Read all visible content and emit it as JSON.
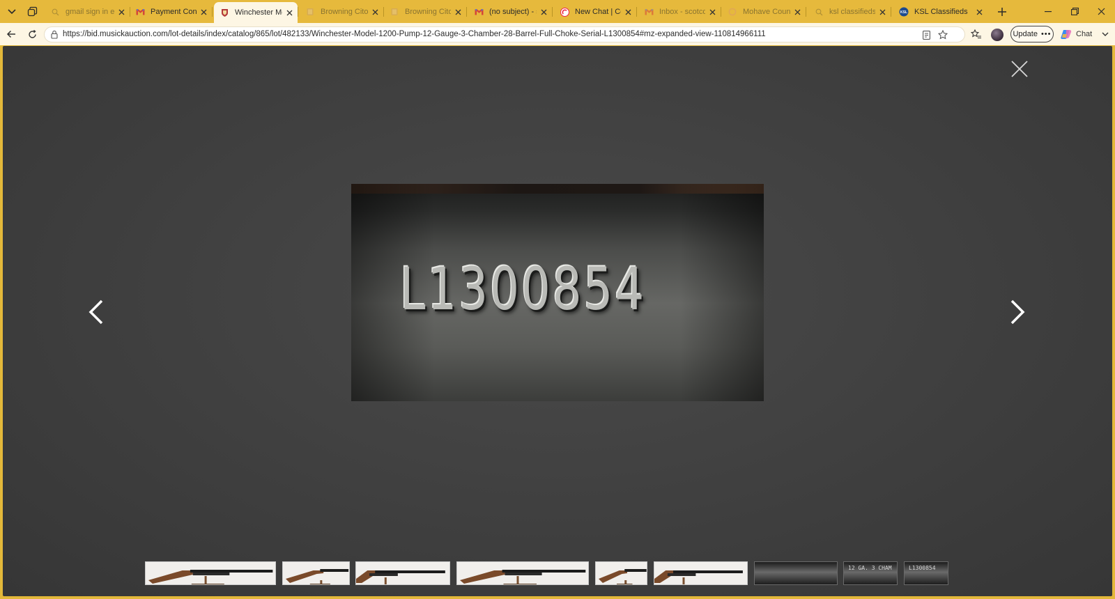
{
  "browser": {
    "tabs": [
      {
        "title": "gmail sign in en",
        "favicon": "search-icon",
        "state": "faded"
      },
      {
        "title": "Payment Confirm",
        "favicon": "gmail-icon",
        "state": "normal"
      },
      {
        "title": "Winchester Mode",
        "favicon": "shield-logo-icon",
        "state": "active"
      },
      {
        "title": "Browning Citori",
        "favicon": "book-icon",
        "state": "faded"
      },
      {
        "title": "Browning Citori",
        "favicon": "book-icon",
        "state": "faded"
      },
      {
        "title": "(no subject) - sco",
        "favicon": "gmail-icon",
        "state": "normal"
      },
      {
        "title": "New Chat | Cdco",
        "favicon": "chat-logo-icon",
        "state": "normal"
      },
      {
        "title": "Inbox - scotcdbu",
        "favicon": "gmail-icon",
        "state": "faded"
      },
      {
        "title": "Mohave County",
        "favicon": "google-icon",
        "state": "faded"
      },
      {
        "title": "ksl classifieds - S",
        "favicon": "search-icon",
        "state": "faded"
      },
      {
        "title": "KSL Classifieds",
        "favicon": "ksl-logo-icon",
        "state": "normal"
      }
    ],
    "url": "https://bid.musickauction.com/lot-details/index/catalog/865/lot/482133/Winchester-Model-1200-Pump-12-Gauge-3-Chamber-28-Barrel-Full-Choke-Serial-L1300854#mz-expanded-view-110814966111",
    "update_label": "Update",
    "chat_label": "Chat",
    "accent_color": "#e6b93c"
  },
  "viewer": {
    "photo_text": "L1300854",
    "thumbnails": [
      {
        "kind": "shotgun-full",
        "text": ""
      },
      {
        "kind": "shotgun-stock",
        "text": ""
      },
      {
        "kind": "shotgun-barrel",
        "text": ""
      },
      {
        "kind": "shotgun-full",
        "text": ""
      },
      {
        "kind": "shotgun-stock",
        "text": ""
      },
      {
        "kind": "shotgun-barrel",
        "text": ""
      },
      {
        "kind": "barrel-closeup",
        "text": ""
      },
      {
        "kind": "barrel-marking",
        "text": "12 GA. 3 CHAM"
      },
      {
        "kind": "serial-closeup",
        "text": "L1300854"
      }
    ]
  }
}
